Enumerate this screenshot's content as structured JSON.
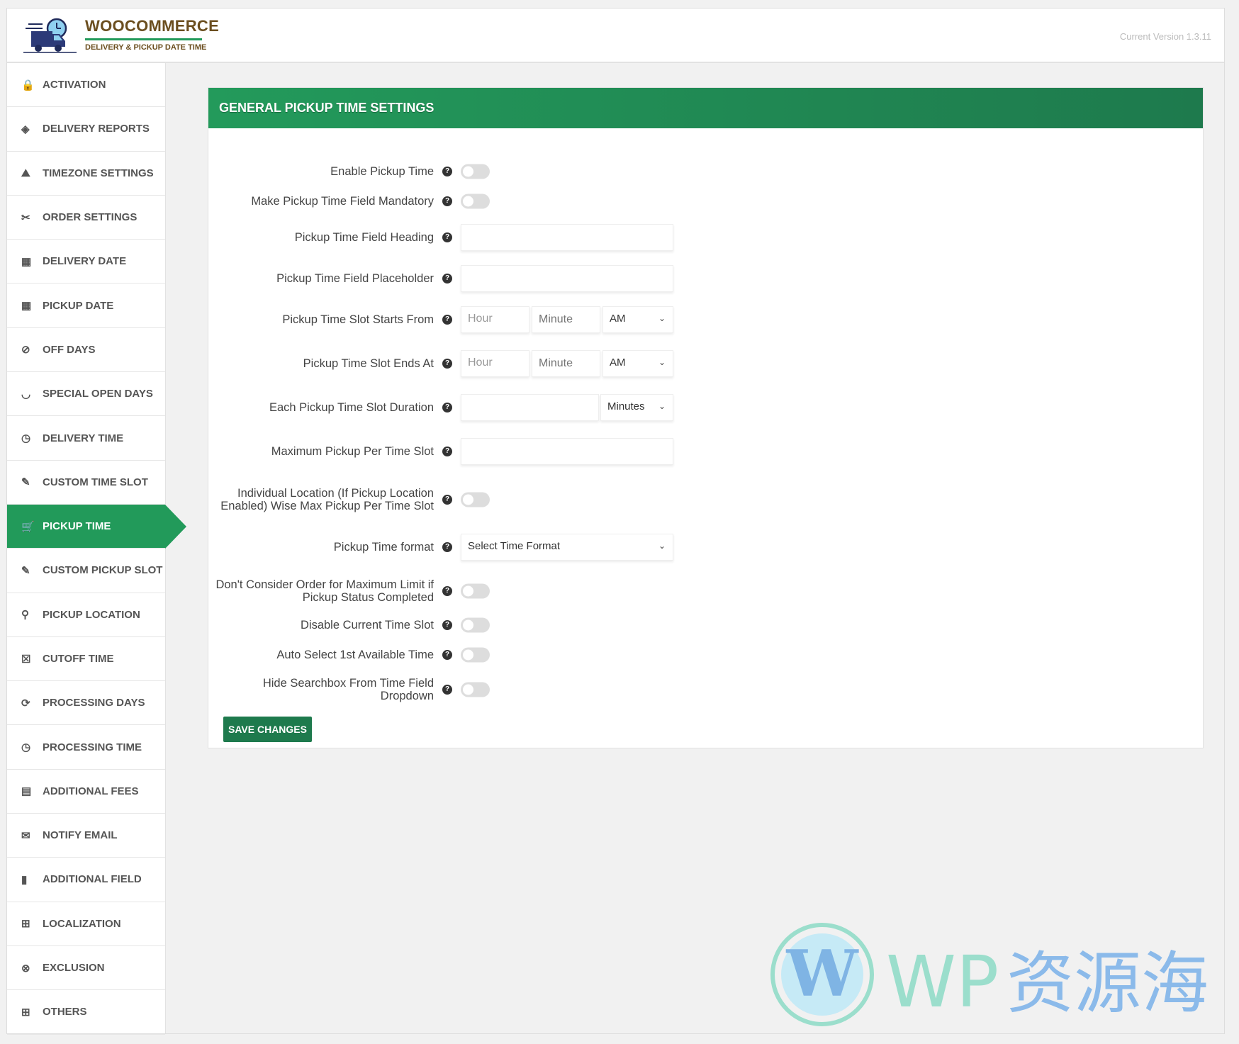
{
  "header": {
    "brand": "WOOCOMMERCE",
    "subtitle": "DELIVERY & PICKUP DATE TIME",
    "version": "Current Version 1.3.11"
  },
  "sidebar": {
    "items": [
      {
        "label": "ACTIVATION",
        "icon": "🔒"
      },
      {
        "label": "DELIVERY REPORTS",
        "icon": "◈"
      },
      {
        "label": "TIMEZONE SETTINGS",
        "icon": "⛰"
      },
      {
        "label": "ORDER SETTINGS",
        "icon": "✂"
      },
      {
        "label": "DELIVERY DATE",
        "icon": "▦"
      },
      {
        "label": "PICKUP DATE",
        "icon": "▦"
      },
      {
        "label": "OFF DAYS",
        "icon": "⊘"
      },
      {
        "label": "SPECIAL OPEN DAYS",
        "icon": "◡"
      },
      {
        "label": "DELIVERY TIME",
        "icon": "◷"
      },
      {
        "label": "CUSTOM TIME SLOT",
        "icon": "✎"
      },
      {
        "label": "PICKUP TIME",
        "icon": "🛒",
        "active": true
      },
      {
        "label": "CUSTOM PICKUP SLOT",
        "icon": "✎"
      },
      {
        "label": "PICKUP LOCATION",
        "icon": "⚲"
      },
      {
        "label": "CUTOFF TIME",
        "icon": "☒"
      },
      {
        "label": "PROCESSING DAYS",
        "icon": "⟳"
      },
      {
        "label": "PROCESSING TIME",
        "icon": "◷"
      },
      {
        "label": "ADDITIONAL FEES",
        "icon": "▤"
      },
      {
        "label": "NOTIFY EMAIL",
        "icon": "✉"
      },
      {
        "label": "ADDITIONAL FIELD",
        "icon": "▮"
      },
      {
        "label": "LOCALIZATION",
        "icon": "⊞"
      },
      {
        "label": "EXCLUSION",
        "icon": "⊗"
      },
      {
        "label": "OTHERS",
        "icon": "⊞"
      }
    ]
  },
  "panel": {
    "title": "GENERAL PICKUP TIME SETTINGS",
    "help": "?",
    "fields": {
      "enable": "Enable Pickup Time",
      "mandatory": "Make Pickup Time Field Mandatory",
      "heading": "Pickup Time Field Heading",
      "placeholder": "Pickup Time Field Placeholder",
      "starts": "Pickup Time Slot Starts From",
      "ends": "Pickup Time Slot Ends At",
      "duration": "Each Pickup Time Slot Duration",
      "max": "Maximum Pickup Per Time Slot",
      "location": "Individual Location (If Pickup Location Enabled) Wise Max Pickup Per Time Slot",
      "format": "Pickup Time format",
      "dont_consider": "Don't Consider Order for Maximum Limit if Pickup Status Completed",
      "disable_current": "Disable Current Time Slot",
      "auto_select": "Auto Select 1st Available Time",
      "hide_search": "Hide Searchbox From Time Field Dropdown"
    },
    "hour_placeholder": "Hour",
    "minute_placeholder": "Minute",
    "ampm": "AM",
    "duration_unit": "Minutes",
    "format_value": "Select Time Format",
    "save": "SAVE CHANGES"
  },
  "watermark": "WP资源海",
  "colors": {
    "accent": "#229a5a",
    "accent_dark": "#1e7a4d",
    "brand": "#6b4e1f"
  }
}
